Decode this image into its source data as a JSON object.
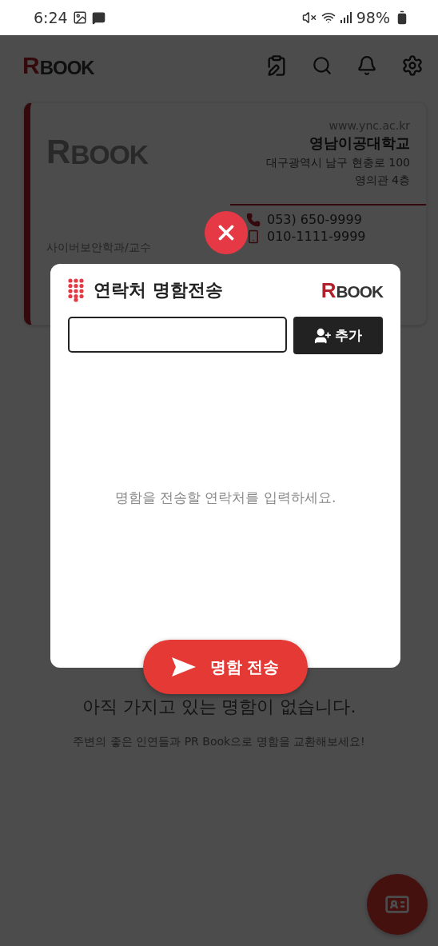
{
  "status_bar": {
    "time": "6:24",
    "battery": "98%"
  },
  "app_bar": {
    "logo": {
      "letter": "R",
      "word": "BOOK"
    }
  },
  "card": {
    "logo": {
      "letter": "R",
      "word": "BOOK"
    },
    "website": "www.ync.ac.kr",
    "organization": "영남이공대학교",
    "address": [
      "대구광역시 남구 현충로 100",
      "영의관 4층"
    ],
    "phone": "053) 650-9999",
    "mobile": "010-1111-9999",
    "position": "사이버보안학과/교수"
  },
  "empty_state": {
    "title": "아직 가지고 있는 명함이 없습니다.",
    "subtitle": "주변의 좋은 인연들과 PR Book으로 명함을 교환해보세요!"
  },
  "dialog": {
    "title": "연락처 명함전송",
    "logo": {
      "letter": "R",
      "word": "BOOK"
    },
    "add_button": "추가",
    "empty_message": "명함을 전송할 연락처를 입력하세요.",
    "send_button": "명함 전송"
  }
}
